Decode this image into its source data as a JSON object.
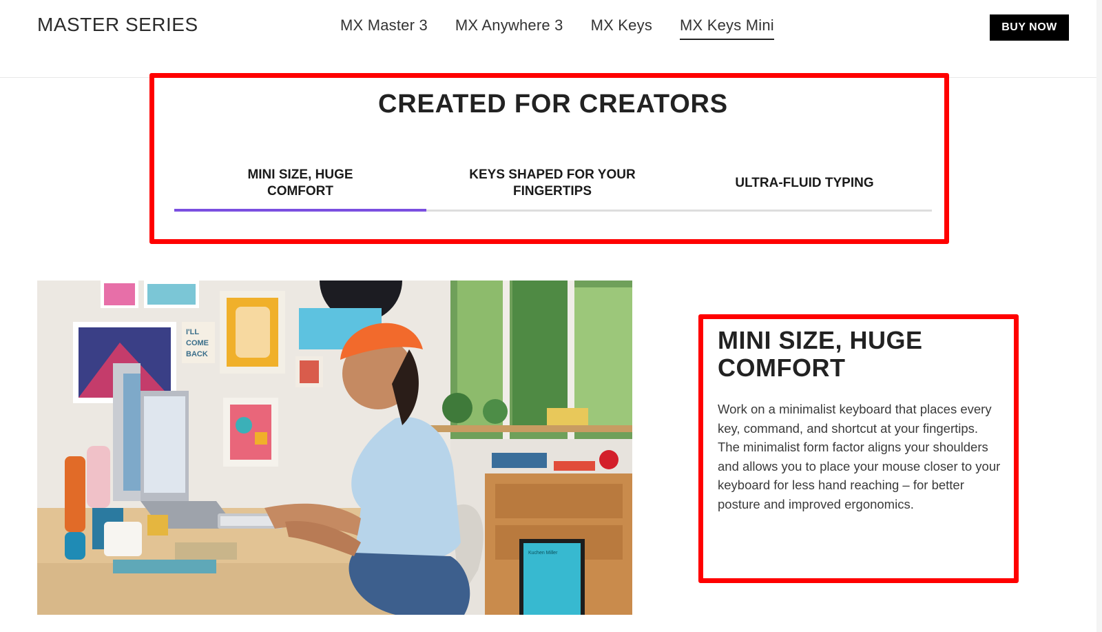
{
  "header": {
    "brand": "MASTER SERIES",
    "nav": [
      {
        "label": "MX Master 3",
        "active": false
      },
      {
        "label": "MX Anywhere 3",
        "active": false
      },
      {
        "label": "MX Keys",
        "active": false
      },
      {
        "label": "MX Keys Mini",
        "active": true
      }
    ],
    "buy_label": "BUY NOW"
  },
  "section": {
    "title": "CREATED FOR CREATORS",
    "tabs": [
      {
        "label": "MINI SIZE, HUGE COMFORT",
        "selected": true
      },
      {
        "label": "KEYS SHAPED FOR YOUR FINGERTIPS",
        "selected": false
      },
      {
        "label": "ULTRA-FLUID TYPING",
        "selected": false
      }
    ],
    "indicator_color": "#7b4fe0"
  },
  "photo": {
    "poster_text": "I'LL COME BACK",
    "book_text": "Kuchen Miller"
  },
  "feature": {
    "title": "MINI SIZE, HUGE COMFORT",
    "paragraphs": [
      "Work on a minimalist keyboard that places every key, command, and shortcut at your fingertips.",
      "The minimalist form factor aligns your shoulders and allows you to place your mouse closer to your keyboard for less hand reaching – for better posture and improved ergonomics."
    ]
  },
  "colors": {
    "highlight": "#ff0000",
    "button_bg": "#000000"
  }
}
